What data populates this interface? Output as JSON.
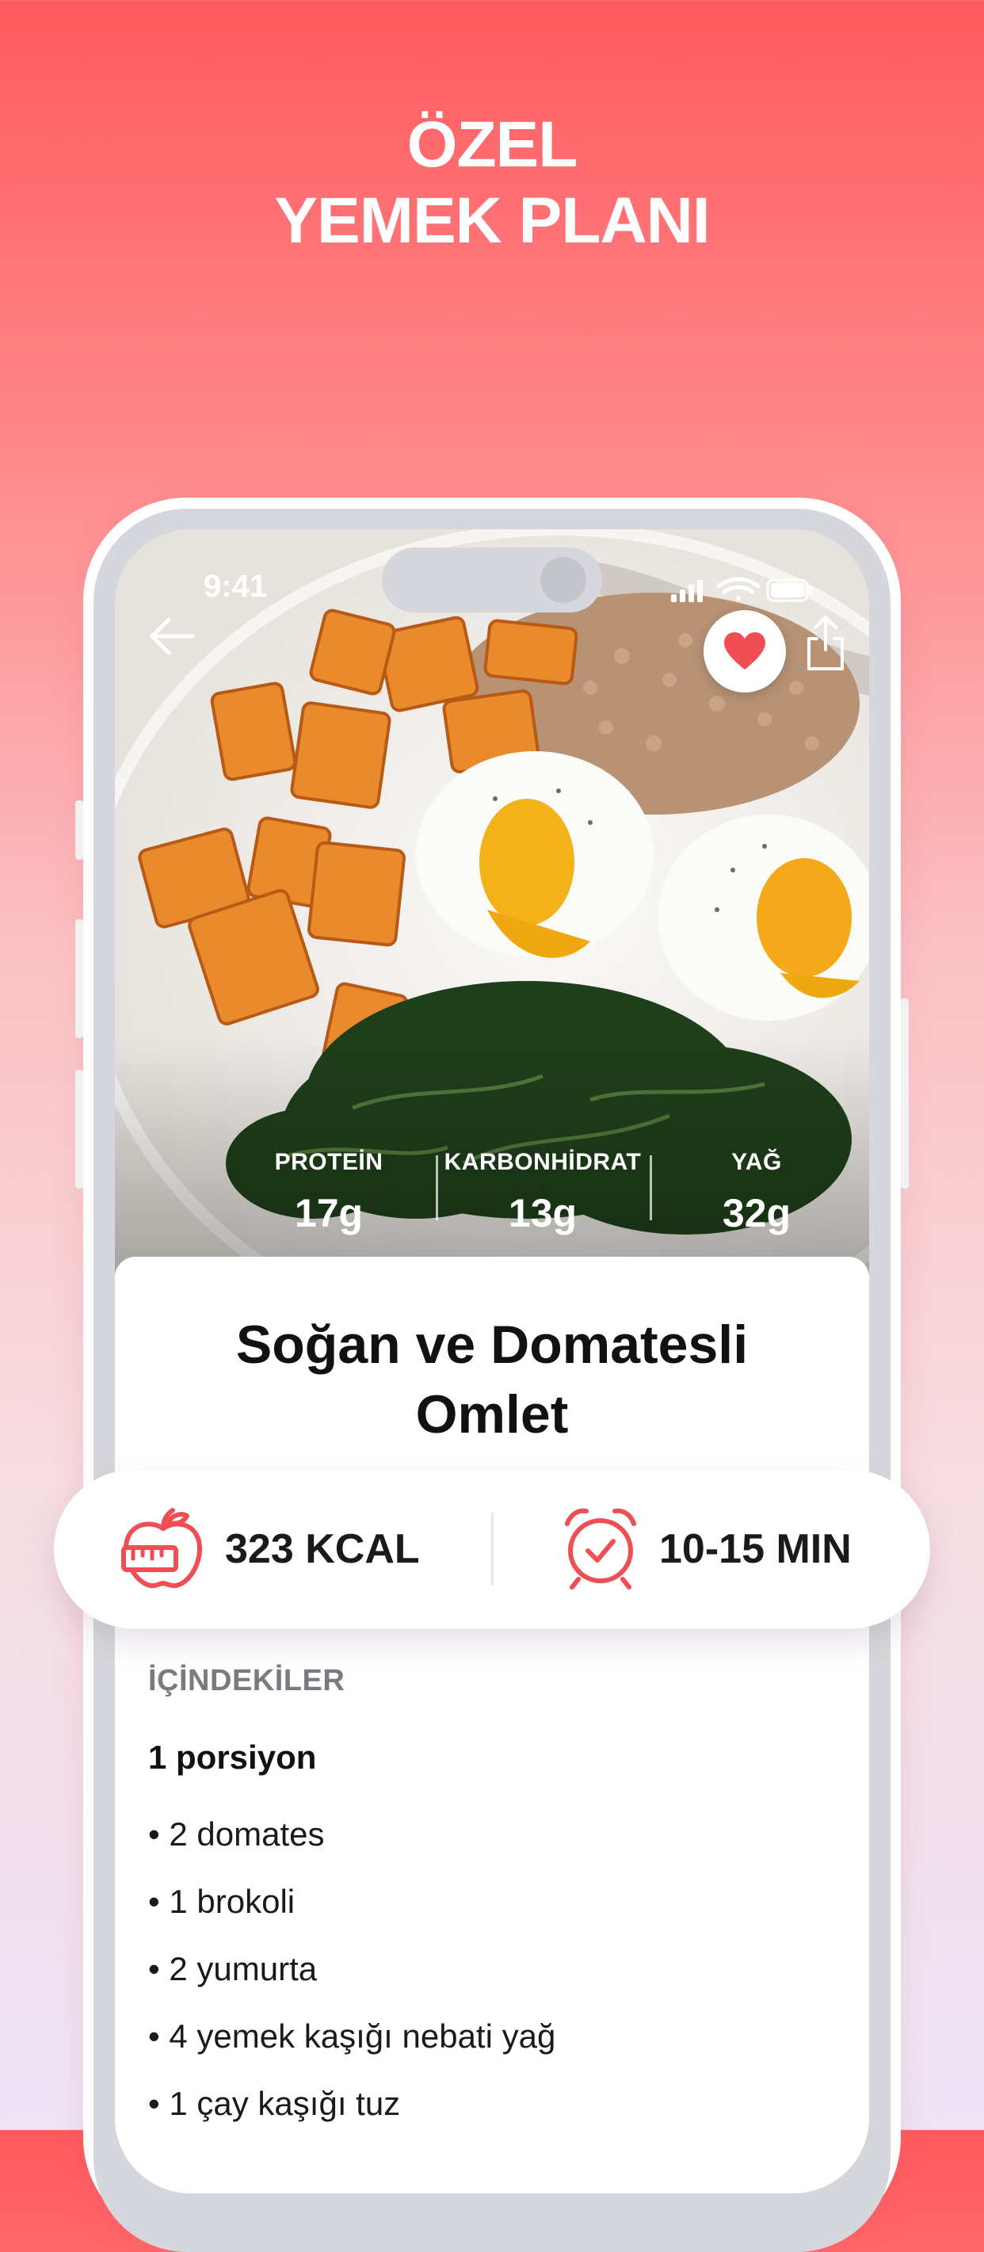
{
  "headline": {
    "line1": "ÖZEL",
    "line2": "YEMEK PLANI"
  },
  "status_bar": {
    "time": "9:41"
  },
  "recipe": {
    "title_line1": "Soğan ve Domatesli",
    "title_line2": "Omlet",
    "macros": [
      {
        "label": "PROTEİN",
        "value": "17g"
      },
      {
        "label": "KARBONHİDRAT",
        "value": "13g"
      },
      {
        "label": "YAĞ",
        "value": "32g"
      }
    ],
    "calories": "323 KCAL",
    "duration": "10-15 MIN",
    "ingredients_title": "İÇİNDEKİLER",
    "portion": "1 porsiyon",
    "ingredients": [
      "2 domates",
      "1 brokoli",
      "2 yumurta",
      "4 yemek kaşığı nebati yağ",
      "1 çay kaşığı tuz"
    ]
  },
  "icons": {
    "back": "back-arrow-icon",
    "favorite": "heart-icon",
    "share": "share-icon",
    "calories": "apple-measure-icon",
    "duration": "alarm-clock-icon"
  },
  "colors": {
    "accent": "#f04e55",
    "heart": "#f04e55"
  }
}
